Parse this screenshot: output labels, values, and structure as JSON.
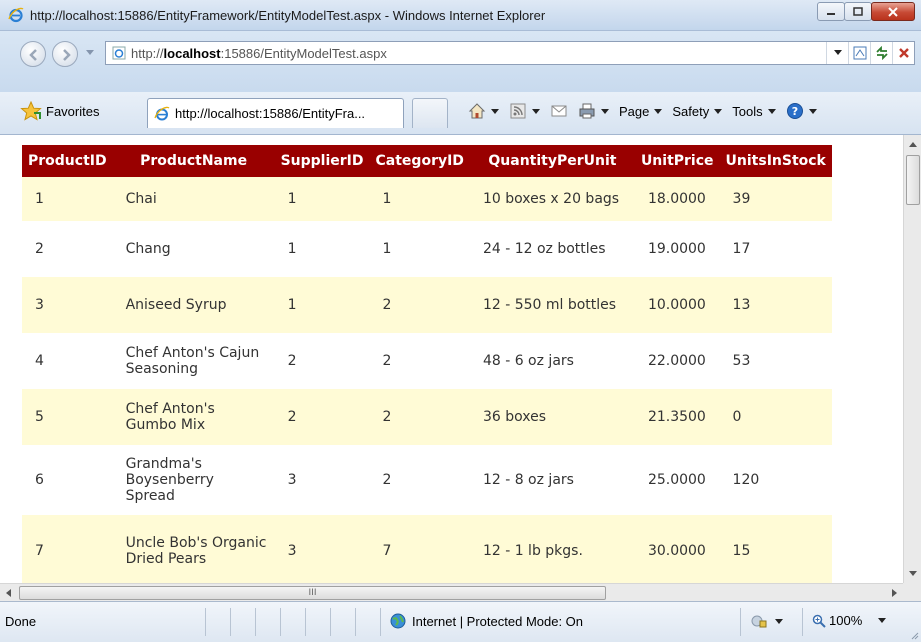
{
  "window": {
    "title": "http://localhost:15886/EntityFramework/EntityModelTest.aspx - Windows Internet Explorer"
  },
  "address_bar": {
    "url_prefix": "http://",
    "url_host": "localhost",
    "url_rest": ":15886/EntityModelTest.aspx"
  },
  "command_bar": {
    "favorites_label": "Favorites",
    "tab_title": "http://localhost:15886/EntityFra...",
    "page_label": "Page",
    "safety_label": "Safety",
    "tools_label": "Tools"
  },
  "grid": {
    "columns": [
      "ProductID",
      "ProductName",
      "SupplierID",
      "CategoryID",
      "QuantityPerUnit",
      "UnitPrice",
      "UnitsInStock"
    ],
    "rows": [
      [
        "1",
        "Chai",
        "1",
        "1",
        "10 boxes x 20 bags",
        "18.0000",
        "39"
      ],
      [
        "2",
        "Chang",
        "1",
        "1",
        "24 - 12 oz bottles",
        "19.0000",
        "17"
      ],
      [
        "3",
        "Aniseed Syrup",
        "1",
        "2",
        "12 - 550 ml bottles",
        "10.0000",
        "13"
      ],
      [
        "4",
        "Chef Anton's Cajun Seasoning",
        "2",
        "2",
        "48 - 6 oz jars",
        "22.0000",
        "53"
      ],
      [
        "5",
        "Chef Anton's Gumbo Mix",
        "2",
        "2",
        "36 boxes",
        "21.3500",
        "0"
      ],
      [
        "6",
        "Grandma's Boysenberry Spread",
        "3",
        "2",
        "12 - 8 oz jars",
        "25.0000",
        "120"
      ],
      [
        "7",
        "Uncle Bob's Organic Dried Pears",
        "3",
        "7",
        "12 - 1 lb pkgs.",
        "30.0000",
        "15"
      ]
    ],
    "header_color": "#990000",
    "odd_row_color": "#fffbd6"
  },
  "scrollbars": {
    "hthumb_glyph": "III"
  },
  "status_bar": {
    "status": "Done",
    "zone": "Internet | Protected Mode: On",
    "zoom": "100%"
  }
}
